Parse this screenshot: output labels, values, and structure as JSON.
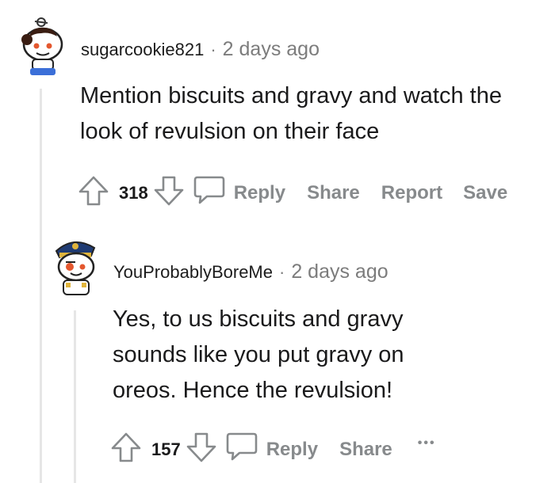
{
  "comments": [
    {
      "username": "sugarcookie821",
      "separator": "·",
      "time": "2 days ago",
      "body_lines": [
        "Mention biscuits and gravy and watch the",
        "look of revulsion on their face"
      ],
      "votes": "318",
      "reply_label": "Reply",
      "share_label": "Share",
      "report_label": "Report",
      "save_label": "Save"
    },
    {
      "username": "YouProbablyBoreMe",
      "separator": "·",
      "time": "2 days ago",
      "body_lines": [
        "Yes, to us biscuits and gravy",
        "sounds like you put gravy on",
        "oreos. Hence the revulsion!"
      ],
      "votes": "157",
      "reply_label": "Reply",
      "share_label": "Share",
      "more_label": "•••"
    }
  ],
  "colors": {
    "meta_gray": "#7c7c7c",
    "action_gray": "#878a8c",
    "thread_line": "#e6e6e6"
  }
}
